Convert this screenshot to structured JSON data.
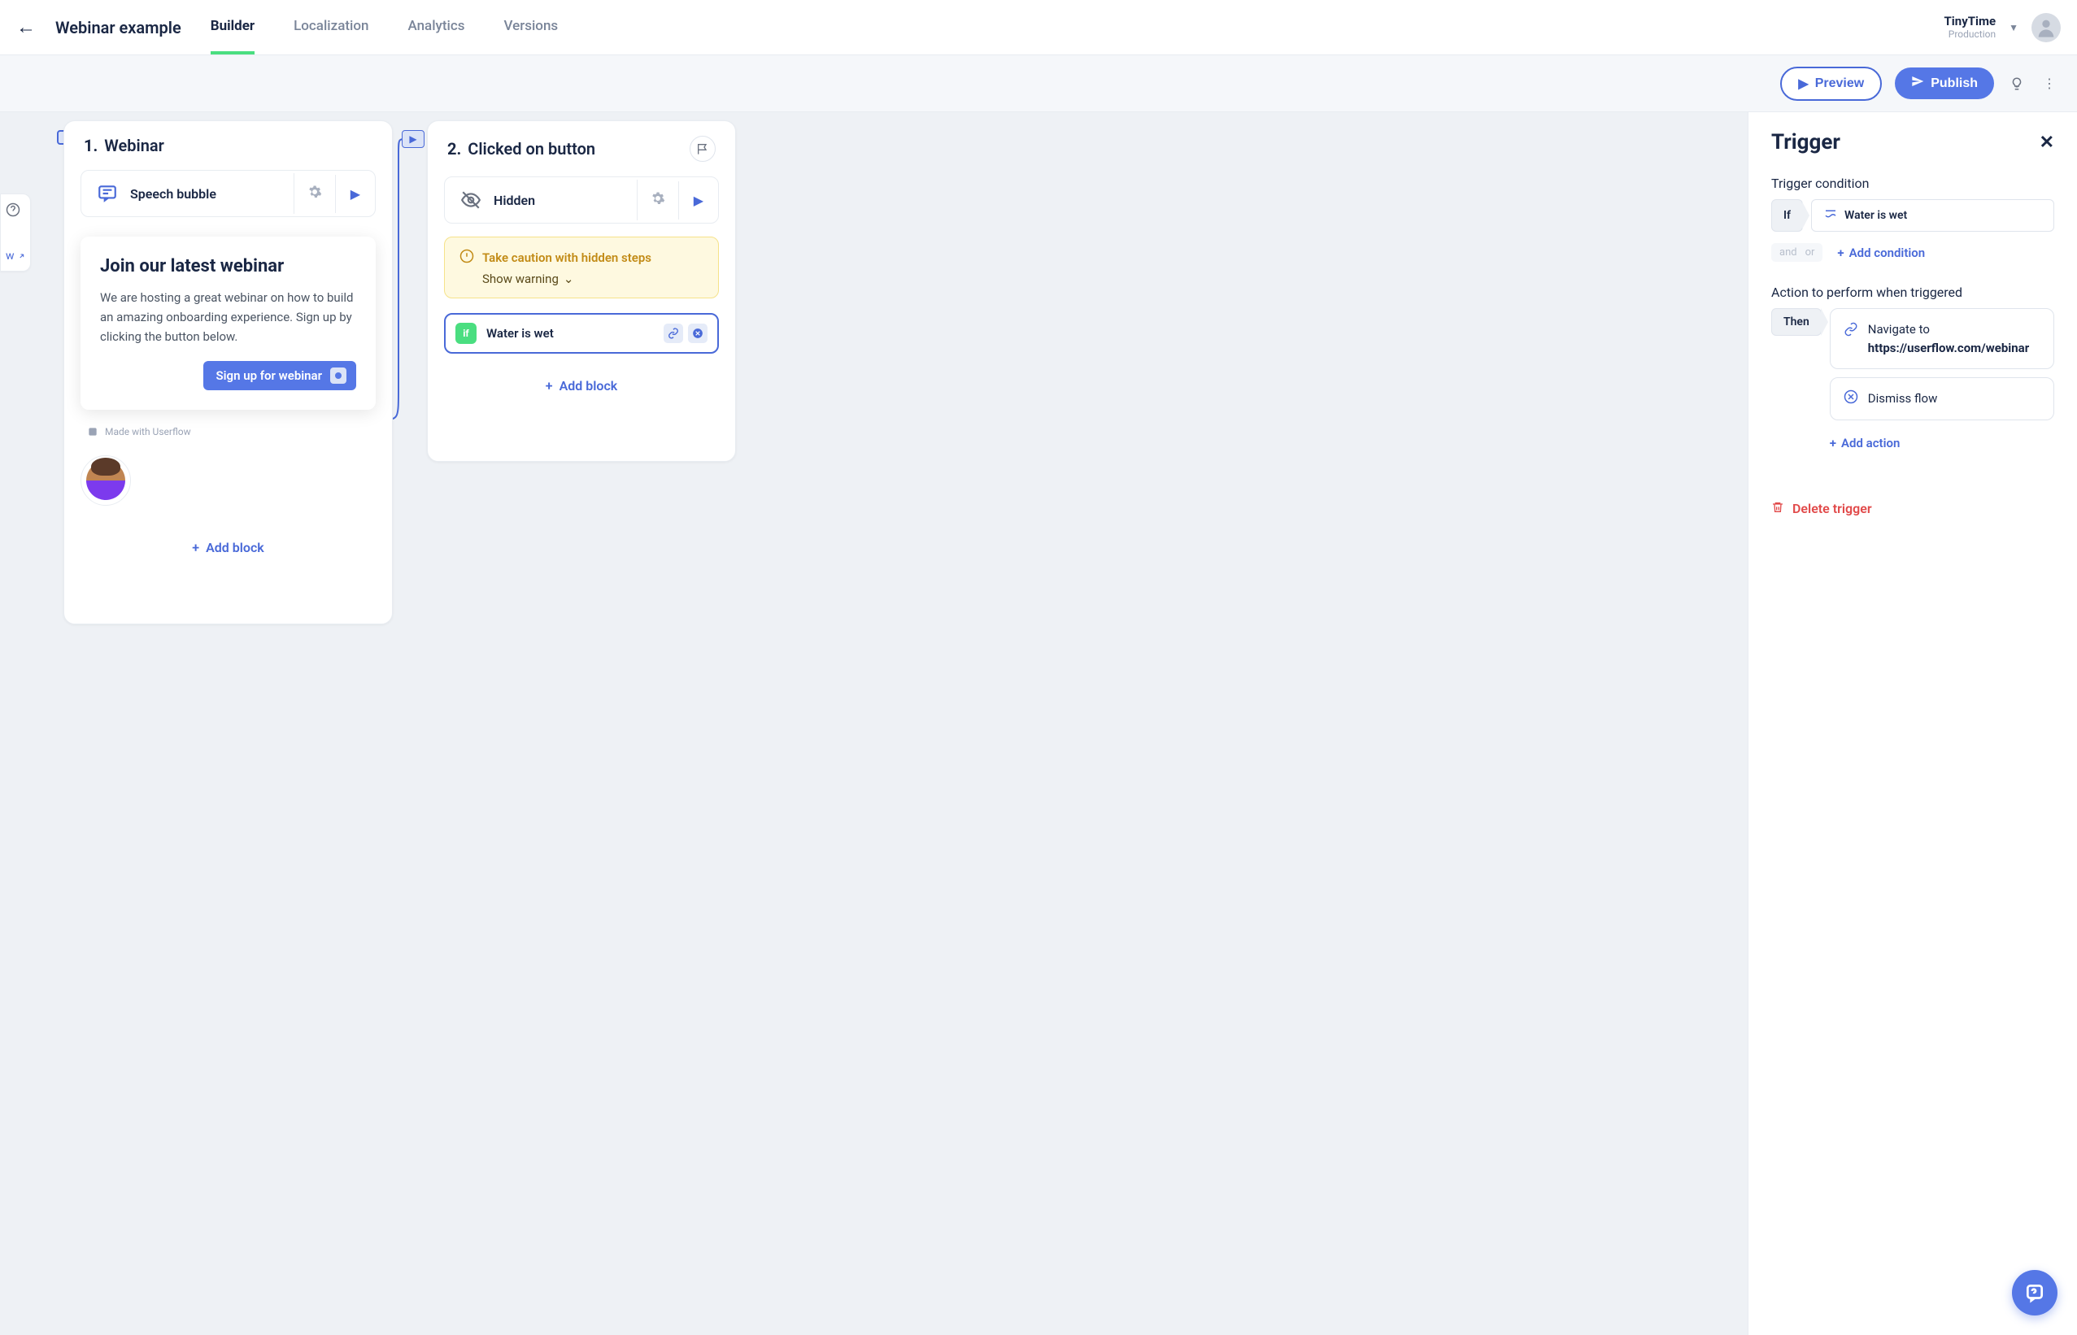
{
  "page_title": "Webinar example",
  "tabs": [
    "Builder",
    "Localization",
    "Analytics",
    "Versions"
  ],
  "active_tab": 0,
  "workspace": {
    "name": "TinyTime",
    "env": "Production"
  },
  "toolbar": {
    "preview": "Preview",
    "publish": "Publish"
  },
  "left_sliver": {
    "help": "?",
    "item2": "w"
  },
  "step1": {
    "number": "1.",
    "title": "Webinar",
    "block_type": "Speech bubble",
    "preview": {
      "heading": "Join our latest webinar",
      "body": "We are hosting a great webinar on how to build an amazing onboarding experience. Sign up by clicking the button below.",
      "cta": "Sign up for webinar"
    },
    "made_with": "Made with Userflow",
    "add_block": "Add block"
  },
  "step2": {
    "number": "2.",
    "title": "Clicked on button",
    "block_type": "Hidden",
    "warning": {
      "title": "Take caution with hidden steps",
      "subtitle": "Show warning"
    },
    "condition": {
      "badge": "if",
      "text": "Water is wet"
    },
    "add_block": "Add block"
  },
  "inspector": {
    "title": "Trigger",
    "condition_section": "Trigger condition",
    "if_label": "If",
    "condition_value": "Water is wet",
    "and": "and",
    "or": "or",
    "add_condition": "Add condition",
    "action_section": "Action to perform when triggered",
    "then_label": "Then",
    "navigate_label": "Navigate to",
    "navigate_url": "https://userflow.com/webinar",
    "dismiss": "Dismiss flow",
    "add_action": "Add action",
    "delete": "Delete trigger"
  }
}
